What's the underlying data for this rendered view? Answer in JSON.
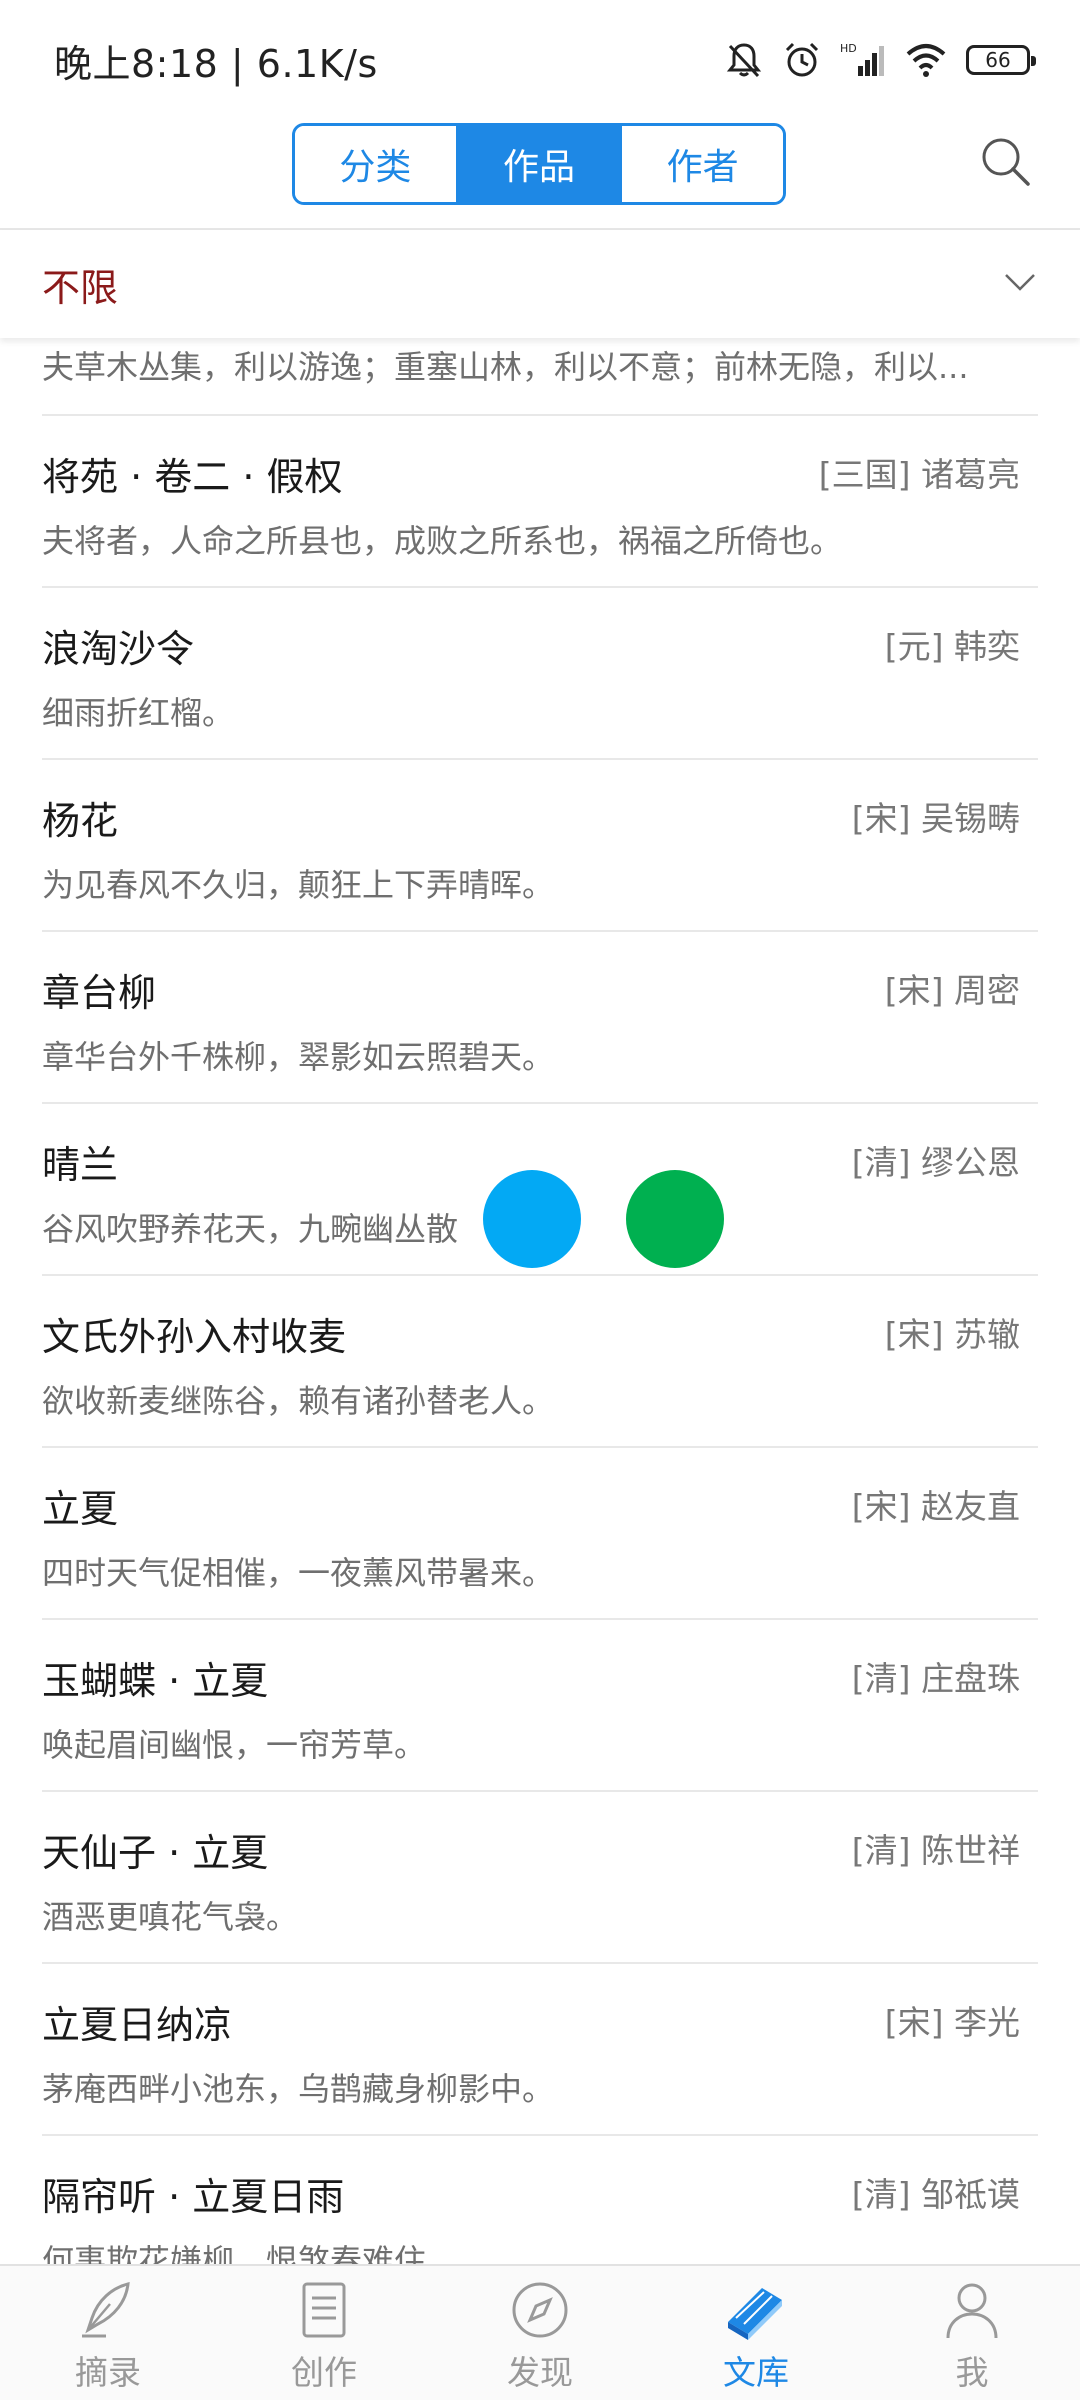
{
  "status_bar": {
    "time_speed": "晚上8:18 | 6.1K/s",
    "network_label": "HD",
    "battery": "66"
  },
  "header": {
    "tabs": [
      {
        "label": "分类",
        "active": false
      },
      {
        "label": "作品",
        "active": true
      },
      {
        "label": "作者",
        "active": false
      }
    ],
    "accent_color": "#1e88e5"
  },
  "filter": {
    "label": "不限",
    "color": "#8b1a1a"
  },
  "partial_item": {
    "excerpt": "夫草木丛集，利以游逸；重塞山林，利以不意；前林无隐，利以..."
  },
  "items": [
    {
      "title": "将苑 · 卷二 · 假权",
      "author": "[三国] 诸葛亮",
      "excerpt": "夫将者，人命之所县也，成败之所系也，祸福之所倚也。"
    },
    {
      "title": "浪淘沙令",
      "author": "[元] 韩奕",
      "excerpt": "细雨折红榴。"
    },
    {
      "title": "杨花",
      "author": "[宋] 吴锡畴",
      "excerpt": "为见春风不久归，颠狂上下弄晴晖。"
    },
    {
      "title": "章台柳",
      "author": "[宋] 周密",
      "excerpt": "章华台外千株柳，翠影如云照碧天。"
    },
    {
      "title": "晴兰",
      "author": "[清] 缪公恩",
      "excerpt": "谷风吹野养花天，九畹幽丛散"
    },
    {
      "title": "文氏外孙入村收麦",
      "author": "[宋] 苏辙",
      "excerpt": "欲收新麦继陈谷，赖有诸孙替老人。"
    },
    {
      "title": "立夏",
      "author": "[宋] 赵友直",
      "excerpt": "四时天气促相催，一夜薰风带暑来。"
    },
    {
      "title": "玉蝴蝶 · 立夏",
      "author": "[清] 庄盘珠",
      "excerpt": "唤起眉间幽恨，一帘芳草。"
    },
    {
      "title": "天仙子 · 立夏",
      "author": "[清] 陈世祥",
      "excerpt": "酒恶更嗔花气袅。"
    },
    {
      "title": "立夏日纳凉",
      "author": "[宋] 李光",
      "excerpt": "茅庵西畔小池东，乌鹊藏身柳影中。"
    },
    {
      "title": "隔帘听 · 立夏日雨",
      "author": "[清] 邹祗谟",
      "excerpt": "何事欺花嫌柳，恨煞春难住。"
    }
  ],
  "floating_dots": {
    "blue_color": "#03a9f4",
    "green_color": "#00b050"
  },
  "bottom_nav": {
    "items": [
      {
        "label": "摘录",
        "icon": "quill-icon",
        "active": false
      },
      {
        "label": "创作",
        "icon": "document-icon",
        "active": false
      },
      {
        "label": "发现",
        "icon": "compass-icon",
        "active": false
      },
      {
        "label": "文库",
        "icon": "books-icon",
        "active": true
      },
      {
        "label": "我",
        "icon": "person-icon",
        "active": false
      }
    ]
  }
}
